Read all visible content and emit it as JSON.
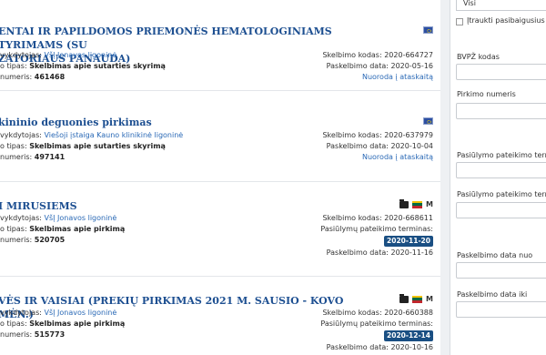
{
  "results": [
    {
      "title_line1": "ENTAI IR PAPILDOMOS PRIEMONĖS HEMATOLOGINIAMS TYRIMAMS (SU",
      "title_line2": "ZATORIAUS PANAUDA)",
      "org_label": "vykdytojas:",
      "org": "VšĮ Jonavos ligoninė",
      "type_label": "o tipas:",
      "type": "Skelbimas apie sutarties skyrimą",
      "num_label": "numeris:",
      "num": "461468",
      "code_label": "Skelbimo kodas:",
      "code": "2020-664727",
      "pub_label": "Paskelbimo data:",
      "pub": "2020-05-16",
      "link": "Nuoroda į ataskaitą"
    },
    {
      "title_line1": "kininio deguonies pirkimas",
      "org_label": "vykdytojas:",
      "org": "Viešoji įstaiga Kauno klinikinė ligoninė",
      "type_label": "o tipas:",
      "type": "Skelbimas apie sutarties skyrimą",
      "num_label": "numeris:",
      "num": "497141",
      "code_label": "Skelbimo kodas:",
      "code": "2020-637979",
      "pub_label": "Paskelbimo data:",
      "pub": "2020-10-04",
      "link": "Nuoroda į ataskaitą"
    },
    {
      "title_line1": "I MIRUSIEMS",
      "org_label": "vykdytojas:",
      "org": "VšĮ Jonavos ligoninė",
      "type_label": "o tipas:",
      "type": "Skelbimas apie pirkimą",
      "num_label": "numeris:",
      "num": "520705",
      "code_label": "Skelbimo kodas:",
      "code": "2020-668611",
      "deadline_label": "Pasiūlymų pateikimo terminas:",
      "deadline": "2020-11-20",
      "pub_label": "Paskelbimo data:",
      "pub": "2020-11-16",
      "m_letter": "M"
    },
    {
      "title_line1": "VĖS IR VAISIAI (PREKIŲ PIRKIMAS 2021 M. SAUSIO - KOVO MĖN.)",
      "org_label": "vykdytojas:",
      "org": "VšĮ Jonavos ligoninė",
      "type_label": "o tipas:",
      "type": "Skelbimas apie pirkimą",
      "num_label": "numeris:",
      "num": "515773",
      "code_label": "Skelbimo kodas:",
      "code": "2020-660388",
      "deadline_label": "Pasiūlymų pateikimo terminas:",
      "deadline": "2020-12-14",
      "pub_label": "Paskelbimo data:",
      "pub": "2020-10-16",
      "m_letter": "M"
    }
  ],
  "sidebar": {
    "select_value": "Visi",
    "include_expired_label": "Įtraukti pasibaigusius s",
    "bvpz_label": "BVPŽ kodas",
    "purchase_num_label": "Pirkimo numeris",
    "deadline_from_label": "Pasiūlymo pateikimo termin",
    "deadline_to_label": "Pasiūlymo pateikimo termin",
    "pub_from_label": "Paskelbimo data nuo",
    "pub_to_label": "Paskelbimo data iki"
  },
  "colors": {
    "title": "#1d4f91",
    "link": "#2a69b6",
    "badge": "#1a4f83"
  }
}
